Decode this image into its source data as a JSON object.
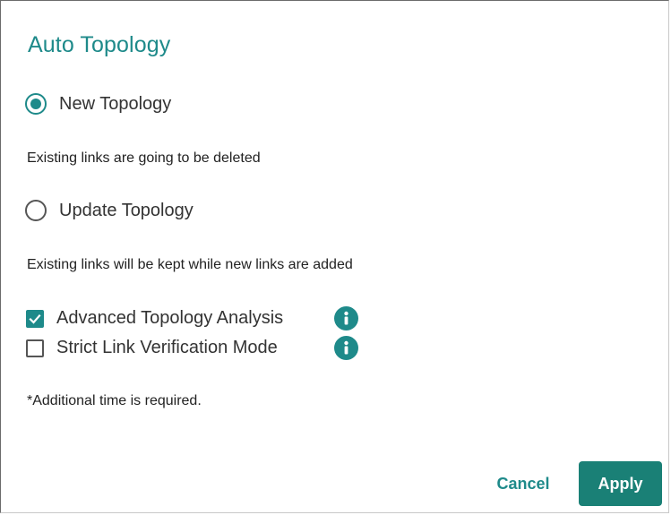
{
  "dialog": {
    "title": "Auto Topology",
    "options": [
      {
        "label": "New Topology",
        "selected": true,
        "description": "Existing links are going to be deleted"
      },
      {
        "label": "Update Topology",
        "selected": false,
        "description": "Existing links will be kept while new links are added"
      }
    ],
    "checkboxes": [
      {
        "label": "Advanced Topology Analysis",
        "checked": true,
        "info_icon": "info-icon"
      },
      {
        "label": "Strict Link Verification Mode",
        "checked": false,
        "info_icon": "info-icon"
      }
    ],
    "note": "*Additional time is required.",
    "buttons": {
      "cancel": "Cancel",
      "apply": "Apply"
    }
  },
  "colors": {
    "accent": "#1e8a8a",
    "apply_button": "#1a8076"
  }
}
